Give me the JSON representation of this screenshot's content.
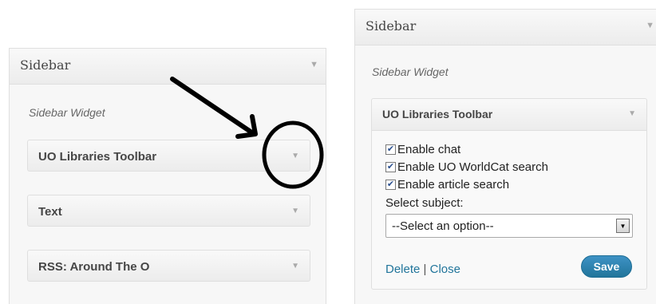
{
  "left_panel": {
    "title": "Sidebar",
    "arrow": "▼",
    "description": "Sidebar Widget",
    "widgets": [
      {
        "title": "UO Libraries Toolbar",
        "arrow": "▼"
      },
      {
        "title": "Text",
        "arrow": "▼"
      },
      {
        "title": "RSS: Around The O",
        "arrow": "▼"
      }
    ]
  },
  "right_panel": {
    "title": "Sidebar",
    "arrow": "▼",
    "description": "Sidebar Widget",
    "widget": {
      "title": "UO Libraries Toolbar",
      "arrow": "▼",
      "options": [
        {
          "label": "Enable chat",
          "checked": true
        },
        {
          "label": "Enable UO WorldCat search",
          "checked": true
        },
        {
          "label": "Enable article search",
          "checked": true
        }
      ],
      "select_label": "Select subject:",
      "select_value": "--Select an option--",
      "delete_link": "Delete",
      "separator": "|",
      "close_link": "Close",
      "save_label": "Save"
    }
  },
  "annotation": {
    "arrow_color": "#000000",
    "circle_color": "#000000"
  },
  "colors": {
    "link": "#21759b",
    "save_button": "#21759b"
  }
}
